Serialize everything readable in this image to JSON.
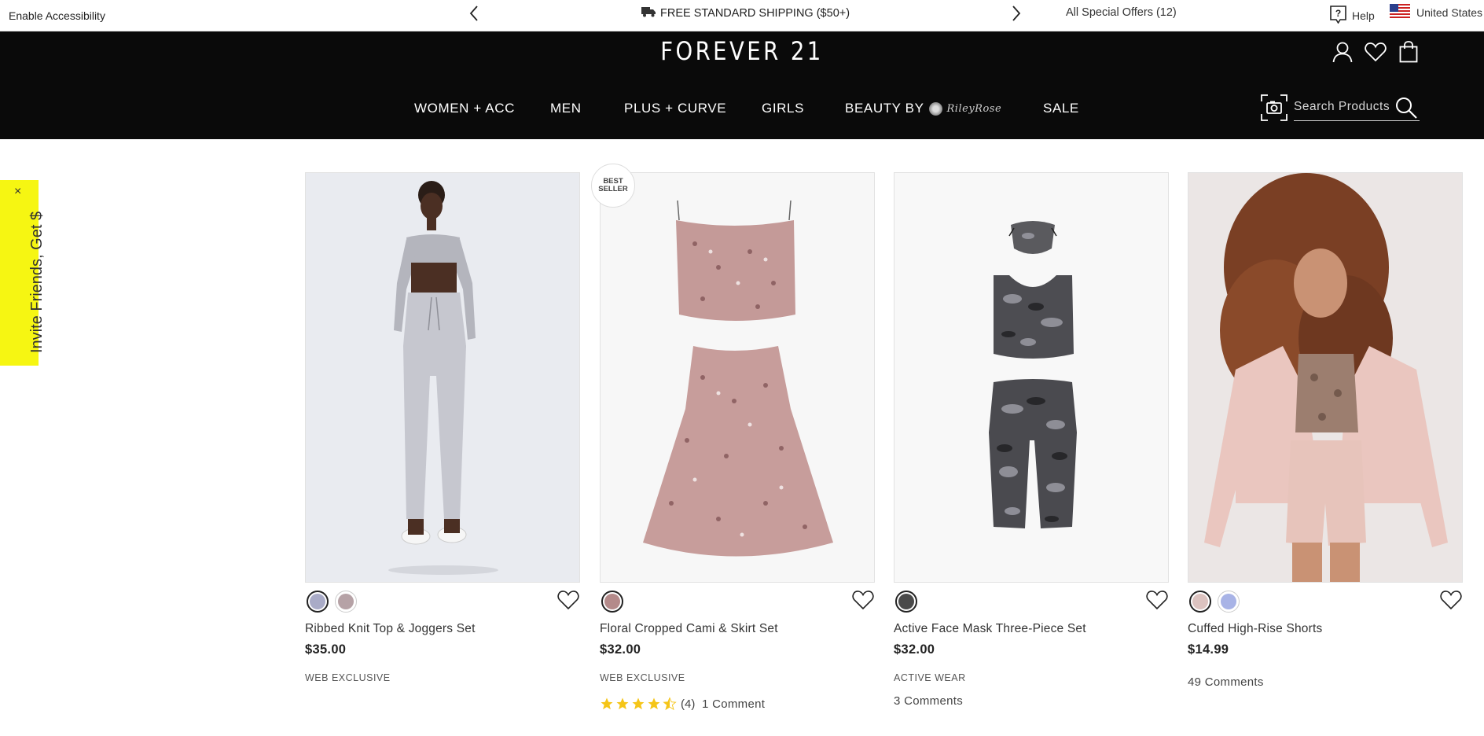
{
  "topbar": {
    "accessibility": "Enable Accessibility",
    "shipping": "FREE STANDARD SHIPPING ($50+)",
    "offers": "All Special Offers (12)",
    "help": "Help",
    "country": "United States"
  },
  "header": {
    "logo": "FOREVER 21",
    "nav": [
      "WOMEN + ACC",
      "MEN",
      "PLUS + CURVE",
      "GIRLS",
      "BEAUTY BY",
      "SALE"
    ],
    "beauty_brand": "RileyRose",
    "search_placeholder": "Search Products"
  },
  "invite": {
    "text": "Invite Friends, Get $",
    "close": "×"
  },
  "products": [
    {
      "name": "Ribbed Knit Top & Joggers Set",
      "price": "$35.00",
      "tag": "WEB EXCLUSIVE",
      "swatches": [
        "#a9abc7",
        "#b6a2a6"
      ],
      "badge": "",
      "rating": null,
      "comments": ""
    },
    {
      "name": "Floral Cropped Cami & Skirt Set",
      "price": "$32.00",
      "tag": "WEB EXCLUSIVE",
      "swatches": [
        "#b48a8a"
      ],
      "badge": "BEST SELLER",
      "rating": 4.5,
      "rating_count": "(4)",
      "comments": "1 Comment"
    },
    {
      "name": "Active Face Mask Three-Piece Set",
      "price": "$32.00",
      "tag": "ACTIVE WEAR",
      "swatches": [
        "#4a4a4a"
      ],
      "badge": "",
      "rating": null,
      "comments": "3 Comments"
    },
    {
      "name": "Cuffed High-Rise Shorts",
      "price": "$14.99",
      "tag": "",
      "swatches": [
        "#dcc3c0",
        "#a8b3e6"
      ],
      "badge": "",
      "rating": null,
      "comments": "49 Comments"
    }
  ],
  "colors": {
    "header_bg": "#0a0a0a",
    "invite_bg": "#f6f612",
    "star": "#f5c518"
  }
}
